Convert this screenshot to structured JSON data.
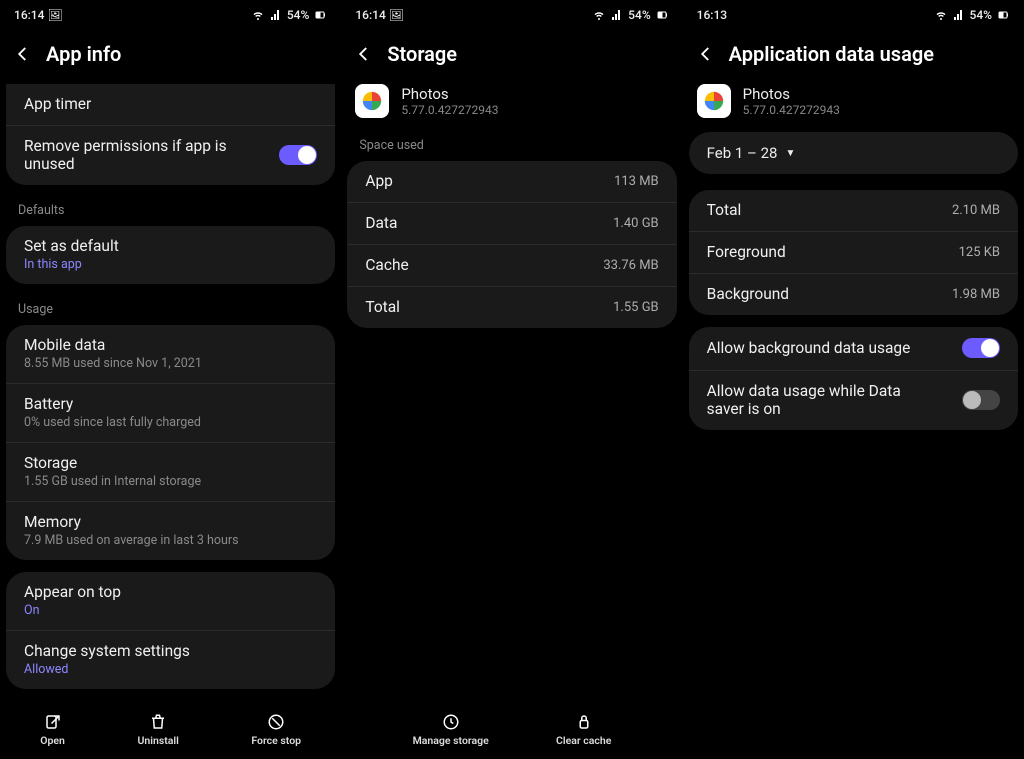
{
  "status": {
    "time_a": "16:14",
    "time_b": "16:14",
    "time_c": "16:13",
    "battery_pct": "54%"
  },
  "screen_a": {
    "title": "App info",
    "app_timer": "App timer",
    "remove_perms": "Remove permissions if app is unused",
    "defaults_label": "Defaults",
    "set_default_title": "Set as default",
    "set_default_sub": "In this app",
    "usage_label": "Usage",
    "mobile_title": "Mobile data",
    "mobile_sub": "8.55 MB used since Nov 1, 2021",
    "battery_title": "Battery",
    "battery_sub": "0% used since last fully charged",
    "storage_title": "Storage",
    "storage_sub": "1.55 GB used in Internal storage",
    "memory_title": "Memory",
    "memory_sub": "7.9 MB used on average in last 3 hours",
    "appear_title": "Appear on top",
    "appear_sub": "On",
    "change_sys_title": "Change system settings",
    "change_sys_sub": "Allowed",
    "bb_open": "Open",
    "bb_uninstall": "Uninstall",
    "bb_force_stop": "Force stop"
  },
  "screen_b": {
    "title": "Storage",
    "app_name": "Photos",
    "app_version": "5.77.0.427272943",
    "space_label": "Space used",
    "rows": {
      "app_label": "App",
      "app_value": "113 MB",
      "data_label": "Data",
      "data_value": "1.40 GB",
      "cache_label": "Cache",
      "cache_value": "33.76 MB",
      "total_label": "Total",
      "total_value": "1.55 GB"
    },
    "bb_manage": "Manage storage",
    "bb_clear_cache": "Clear cache"
  },
  "screen_c": {
    "title": "Application data usage",
    "app_name": "Photos",
    "app_version": "5.77.0.427272943",
    "date_range": "Feb 1 – 28",
    "rows": {
      "total_label": "Total",
      "total_value": "2.10 MB",
      "fg_label": "Foreground",
      "fg_value": "125 KB",
      "bg_label": "Background",
      "bg_value": "1.98 MB"
    },
    "allow_bg": "Allow background data usage",
    "allow_saver": "Allow data usage while Data saver is on"
  }
}
